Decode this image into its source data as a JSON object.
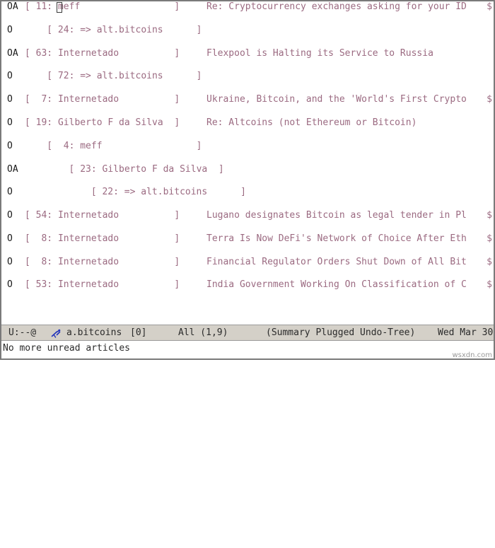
{
  "window": {
    "background": "#ffffff",
    "text_color": "#9b6a81",
    "mark_color": "#1a1a1a",
    "modeline_background": "#d4d0c8"
  },
  "summary": {
    "rows": [
      {
        "mark": "OA",
        "indent": 0,
        "open_bracket": "[",
        "number": "11:",
        "author": "meff",
        "close_bracket": "]",
        "subject": "Re: Cryptocurrency exchanges asking for your ID",
        "truncated": "$",
        "cursor": true
      },
      {
        "mark": "O",
        "indent": 1,
        "open_bracket": "[",
        "number": "24:",
        "author": "=> alt.bitcoins",
        "close_bracket": "]",
        "subject": "",
        "truncated": "",
        "cursor": false
      },
      {
        "mark": "OA",
        "indent": 0,
        "open_bracket": "[",
        "number": "63:",
        "author": "Internetado",
        "close_bracket": "]",
        "subject": "Flexpool is Halting its Service to Russia",
        "truncated": "",
        "cursor": false
      },
      {
        "mark": "O",
        "indent": 1,
        "open_bracket": "[",
        "number": "72:",
        "author": "=> alt.bitcoins",
        "close_bracket": "]",
        "subject": "",
        "truncated": "",
        "cursor": false
      },
      {
        "mark": "O",
        "indent": 0,
        "open_bracket": "[",
        "number": "7:",
        "author": "Internetado",
        "close_bracket": "]",
        "subject": "Ukraine, Bitcoin, and the 'World's First Crypto",
        "truncated": "$",
        "cursor": false
      },
      {
        "mark": "O",
        "indent": 0,
        "open_bracket": "[",
        "number": "19:",
        "author": "Gilberto F da Silva",
        "close_bracket": "]",
        "subject": "Re: Altcoins (not Ethereum or Bitcoin)",
        "truncated": "",
        "cursor": false
      },
      {
        "mark": "O",
        "indent": 1,
        "open_bracket": "[",
        "number": "4:",
        "author": "meff",
        "close_bracket": "]",
        "subject": "",
        "truncated": "",
        "cursor": false
      },
      {
        "mark": "OA",
        "indent": 2,
        "open_bracket": "[",
        "number": "23:",
        "author": "Gilberto F da Silva",
        "close_bracket": "]",
        "subject": "",
        "truncated": "",
        "cursor": false
      },
      {
        "mark": "O",
        "indent": 3,
        "open_bracket": "[",
        "number": "22:",
        "author": "=> alt.bitcoins",
        "close_bracket": "]",
        "subject": "",
        "truncated": "",
        "cursor": false
      },
      {
        "mark": "O",
        "indent": 0,
        "open_bracket": "[",
        "number": "54:",
        "author": "Internetado",
        "close_bracket": "]",
        "subject": "Lugano designates Bitcoin as legal tender in Pl",
        "truncated": "$",
        "cursor": false
      },
      {
        "mark": "O",
        "indent": 0,
        "open_bracket": "[",
        "number": "8:",
        "author": "Internetado",
        "close_bracket": "]",
        "subject": "Terra Is Now DeFi's Network of Choice After Eth",
        "truncated": "$",
        "cursor": false
      },
      {
        "mark": "O",
        "indent": 0,
        "open_bracket": "[",
        "number": "8:",
        "author": "Internetado",
        "close_bracket": "]",
        "subject": "Financial Regulator Orders Shut Down of All Bit",
        "truncated": "$",
        "cursor": false
      },
      {
        "mark": "O",
        "indent": 0,
        "open_bracket": "[",
        "number": "53:",
        "author": "Internetado",
        "close_bracket": "]",
        "subject": "India Government Working On Classification of C",
        "truncated": "$",
        "cursor": false
      }
    ]
  },
  "modeline": {
    "status": "U:--@",
    "icon": "gnus-icon",
    "buffer_name": "a.bitcoins",
    "unread_count": "[0]",
    "position": "All (1,9)",
    "modes": "(Summary Plugged Undo-Tree)",
    "date": "Wed Mar 30"
  },
  "echo_area": {
    "message": "No more unread articles"
  },
  "watermark": {
    "text": "wsxdn.com"
  }
}
